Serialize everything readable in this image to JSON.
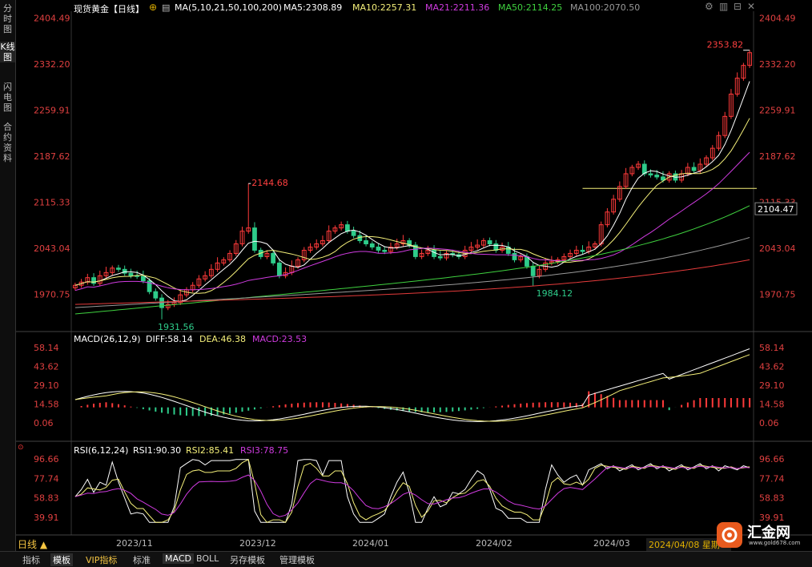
{
  "header": {
    "title": "现货黄金【日线】",
    "ma_label": "MA(5,10,21,50,100,200)",
    "ma5": "MA5:2308.89",
    "ma10": "MA10:2257.31",
    "ma21": "MA21:2211.36",
    "ma50": "MA50:2114.25",
    "ma100": "MA100:2070.50"
  },
  "sidebar": {
    "items": [
      "分时图",
      "K线图",
      "闪电图",
      "合约资料"
    ]
  },
  "price_axis": [
    "2404.49",
    "2332.20",
    "2259.91",
    "2187.62",
    "2115.33",
    "2043.04",
    "1970.75"
  ],
  "price_current": "2104.47",
  "price_annotations": {
    "high1": "2144.68",
    "low1": "1931.56",
    "low2": "1984.12",
    "high2": "2353.82"
  },
  "macd": {
    "label": "MACD(26,12,9)",
    "diff": "DIFF:58.14",
    "dea": "DEA:46.38",
    "macd": "MACD:23.53",
    "axis": [
      "58.14",
      "43.62",
      "29.10",
      "14.58",
      "0.06"
    ]
  },
  "rsi": {
    "label": "RSI(6,12,24)",
    "rsi1": "RSI1:90.30",
    "rsi2": "RSI2:85.41",
    "rsi3": "RSI3:78.75",
    "axis": [
      "96.66",
      "77.74",
      "58.83",
      "39.91"
    ]
  },
  "x_axis": [
    "2023/11",
    "2023/12",
    "2024/01",
    "2024/02",
    "2024/03",
    "2024/04/08 星期一"
  ],
  "period_label": "日线 ▲",
  "footer_tabs": [
    "指标",
    "模板",
    "VIP指标",
    "标准",
    "MACD",
    "BOLL",
    "另存模板",
    "管理模板"
  ],
  "logo": {
    "name": "汇金网",
    "url": "www.gold678.com"
  },
  "colors": {
    "up": "#ff3a3a",
    "down": "#2ecc8a",
    "ma5": "#ffffff",
    "ma10": "#f5f07a",
    "ma21": "#d03be0",
    "ma50": "#3fd13f",
    "ma100": "#9a9a9a",
    "ma200": "#e53b3b"
  },
  "chart_data": {
    "type": "candlestick",
    "series_count": 110,
    "price_range": [
      1930,
      2410
    ],
    "support_line": 2137,
    "closes": [
      1985,
      1990,
      1997,
      1988,
      2000,
      2005,
      2012,
      2010,
      2004,
      2000,
      1999,
      1992,
      1975,
      1965,
      1950,
      1955,
      1958,
      1970,
      1978,
      1985,
      1995,
      2000,
      2010,
      2020,
      2025,
      2035,
      2050,
      2070,
      2075,
      2040,
      2030,
      2035,
      2020,
      2000,
      2005,
      2015,
      2025,
      2040,
      2045,
      2050,
      2055,
      2070,
      2075,
      2080,
      2070,
      2063,
      2055,
      2050,
      2045,
      2040,
      2038,
      2045,
      2050,
      2055,
      2048,
      2030,
      2035,
      2040,
      2030,
      2028,
      2035,
      2033,
      2030,
      2040,
      2045,
      2048,
      2055,
      2050,
      2040,
      2045,
      2035,
      2025,
      2030,
      2015,
      2000,
      2010,
      2020,
      2022,
      2025,
      2030,
      2035,
      2040,
      2038,
      2045,
      2050,
      2080,
      2100,
      2120,
      2140,
      2160,
      2170,
      2175,
      2160,
      2158,
      2155,
      2150,
      2160,
      2150,
      2160,
      2170,
      2165,
      2175,
      2185,
      2200,
      2220,
      2250,
      2285,
      2310,
      2330,
      2350
    ],
    "macd_hist_peak": 36,
    "rsi_last": 90.3
  }
}
